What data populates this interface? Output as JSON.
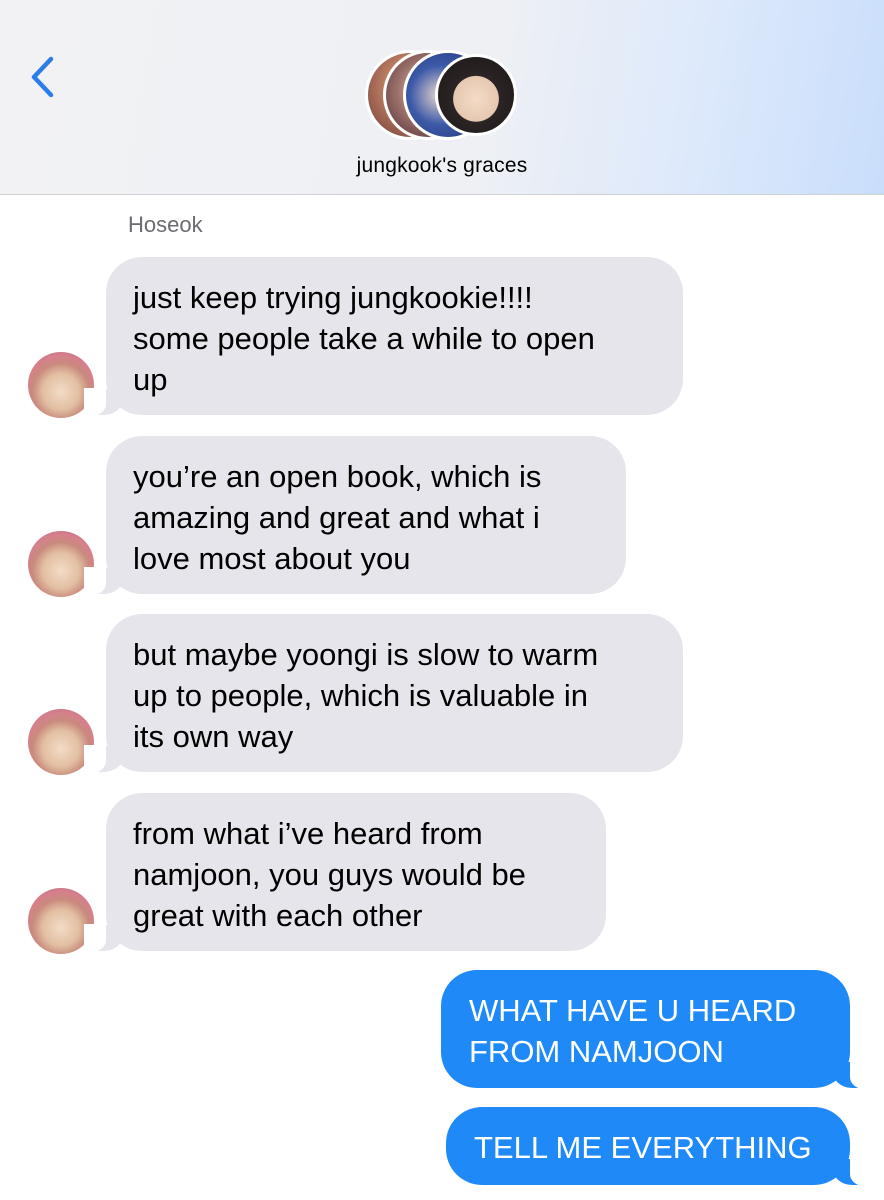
{
  "header": {
    "group_name": "jungkook's graces",
    "back_icon": "chevron-left-icon",
    "accent_color": "#2b7de9"
  },
  "conversation": {
    "sender_name": "Hoseok",
    "incoming": [
      {
        "text": "just keep trying jungkookie!!!!\nsome people take a while to open\nup"
      },
      {
        "text": "you’re an open book, which is\namazing and great and what i\nlove most about you"
      },
      {
        "text": "but maybe yoongi is slow to warm\nup to people, which is valuable in\nits own way"
      },
      {
        "text": "from what i’ve heard from\nnamjoon, you guys would be\ngreat with each other"
      }
    ],
    "outgoing": [
      {
        "text": "WHAT HAVE U HEARD\nFROM NAMJOON"
      },
      {
        "text": "TELL ME EVERYTHING"
      }
    ]
  },
  "colors": {
    "incoming_bubble": "#e6e5eb",
    "outgoing_bubble": "#1f8af7"
  }
}
